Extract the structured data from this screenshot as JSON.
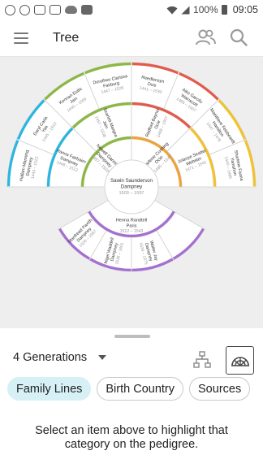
{
  "status_bar": {
    "battery": "100%",
    "time": "09:05",
    "left_icons": [
      "settings-icon",
      "mail-icon",
      "gmail-icon",
      "sim-icon",
      "cloud-icon",
      "news-icon"
    ]
  },
  "app_bar": {
    "title": "Tree",
    "icons": [
      "menu-icon",
      "persons-icon",
      "search-icon"
    ]
  },
  "fan_chart": {
    "center": {
      "name": [
        "Sawin Saunderson",
        "Dampney"
      ],
      "dates": "1509 – 1597"
    },
    "gen1": [
      {
        "name": [
          "Newell Gannon",
          "Dampney"
        ],
        "dates": "1487 – 1520",
        "line": "green"
      },
      {
        "name": [
          "Sharlene Cushing",
          "Ocie"
        ],
        "dates": "1485 – 1543",
        "line": "orange"
      },
      {
        "name": [
          "Henna Randtell",
          "Paris"
        ],
        "dates": "1512 – 1543",
        "line": "purple"
      }
    ],
    "gen2": [
      {
        "name": [
          "Hanna Fairbairn",
          "Dampney"
        ],
        "dates": "1448 – 1513",
        "line": "blue"
      },
      {
        "name": [
          "Scarlett Margea",
          "Jain"
        ],
        "dates": "1457 – 1538",
        "line": "green"
      },
      {
        "name": [
          "Radford Bayner",
          "Ocie"
        ],
        "dates": "1468 – 1507",
        "line": "red"
      },
      {
        "name": [
          "Jolanye Seattel",
          "Webster"
        ],
        "dates": "1471 – 1542",
        "line": "yellow"
      },
      {
        "name": [
          "Manfread Paxtth",
          "Dampney"
        ],
        "dates": "1526 – 1587",
        "line": "purple"
      },
      {
        "name": [
          "Nigel Waddell",
          "Dampney"
        ],
        "dates": "1536 – 1601",
        "line": "purple"
      },
      {
        "name": [
          "Walter Jay",
          "Dampney"
        ],
        "dates": "1534 – 1575",
        "line": "purple"
      },
      {
        "name": [],
        "dates": "",
        "line": "purple"
      }
    ],
    "gen3": [
      {
        "name": [
          "Hallam Manning",
          "Dampney"
        ],
        "dates": "1443 – 1522",
        "line": "blue"
      },
      {
        "name": [
          "Daryl Carla",
          "Yim"
        ],
        "dates": "1445 – 1513",
        "line": "blue"
      },
      {
        "name": [
          "Kennan Estlic",
          "Jain"
        ],
        "dates": "1445 – 1509",
        "line": "green"
      },
      {
        "name": [
          "Dorothee Clarissa",
          "Fairburg"
        ],
        "dates": "1447 – 1528",
        "line": "green"
      },
      {
        "name": [
          "Reedlensyn",
          "Ocie"
        ],
        "dates": "1441 – 1530",
        "line": "red"
      },
      {
        "name": [
          "Aiko Garcilu",
          "Wainscott"
        ],
        "dates": "1485 – 1507",
        "line": "red"
      },
      {
        "name": [
          "Maeithere Felsbeardt",
          "Hamilton"
        ],
        "dates": "1447 – 1478",
        "line": "yellow"
      },
      {
        "name": [
          "Sharlene Fauna",
          "Yamshon"
        ],
        "dates": "1440 – 1486",
        "line": "yellow"
      }
    ],
    "line_colors": {
      "blue": "#29b6e0",
      "green": "#8ab842",
      "red": "#e35a4a",
      "orange": "#f0a23a",
      "yellow": "#f2c230",
      "purple": "#a46fd1"
    }
  },
  "panel": {
    "generations": "4 Generations",
    "view_icons": [
      "tree-view-icon",
      "fan-view-icon"
    ],
    "chips": [
      {
        "label": "Family Lines",
        "active": true
      },
      {
        "label": "Birth Country",
        "active": false
      },
      {
        "label": "Sources",
        "active": false
      }
    ],
    "hint": "Select an item above to highlight that category on the pedigree."
  },
  "colors": {
    "chip_active_bg": "#d6f0f6",
    "canvas_bg": "#eeeeee"
  }
}
